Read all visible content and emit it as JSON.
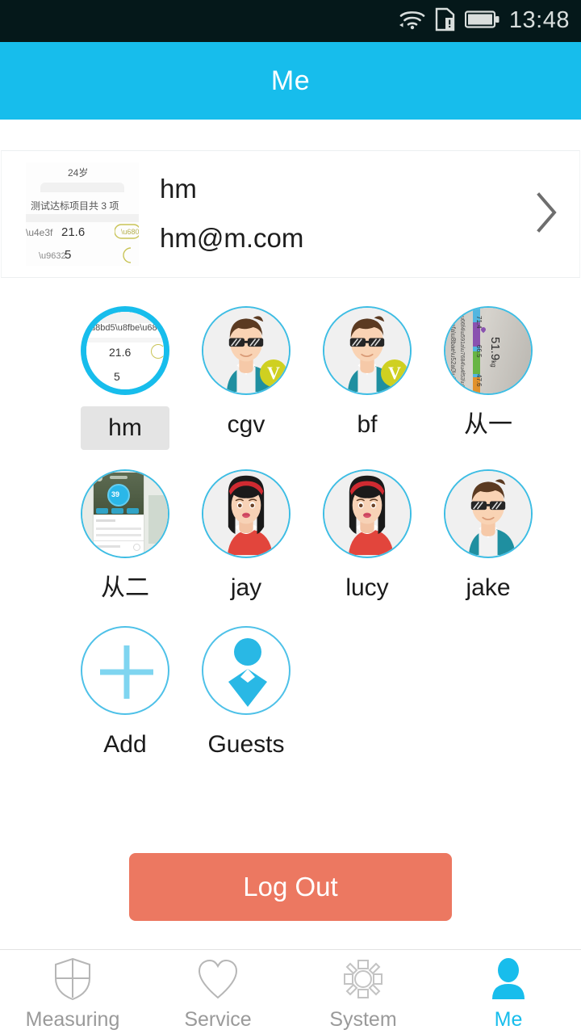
{
  "status_bar": {
    "time": "13:48",
    "icons": [
      "wifi-icon",
      "sim-card-alert-icon",
      "battery-icon"
    ],
    "background": "#05181a"
  },
  "header": {
    "title": "Me",
    "background": "#17bdec",
    "text_color": "#ffffff"
  },
  "profile_card": {
    "name": "hm",
    "email": "hm@m.com",
    "chevron": "chevron-right-icon",
    "thumbnail": {
      "type": "report-screenshot",
      "lines": [
        "24岁",
        "测试达标项目共 3 项",
        "21.6",
        "5"
      ],
      "highlight_value": "3"
    }
  },
  "members": [
    {
      "label": "hm",
      "avatar": "report-thumbnail",
      "selected": true,
      "verified": false
    },
    {
      "label": "cgv",
      "avatar": "male-sunglasses",
      "selected": false,
      "verified": true
    },
    {
      "label": "bf",
      "avatar": "male-sunglasses",
      "selected": false,
      "verified": true
    },
    {
      "label": "从一",
      "avatar": "scale-photo",
      "selected": false,
      "verified": false
    },
    {
      "label": "从二",
      "avatar": "app-screenshot",
      "selected": false,
      "verified": false
    },
    {
      "label": "jay",
      "avatar": "female-headband",
      "selected": false,
      "verified": false
    },
    {
      "label": "lucy",
      "avatar": "female-headband",
      "selected": false,
      "verified": false
    },
    {
      "label": "jake",
      "avatar": "male-sunglasses",
      "selected": false,
      "verified": false
    }
  ],
  "actions": [
    {
      "label": "Add",
      "icon": "plus-icon"
    },
    {
      "label": "Guests",
      "icon": "guest-person-icon"
    }
  ],
  "logout": {
    "label": "Log Out",
    "color": "#ec7861"
  },
  "tabbar": {
    "active_index": 3,
    "active_color": "#17bdec",
    "inactive_color": "#9a9a9a",
    "tabs": [
      {
        "label": "Measuring",
        "icon": "shield-icon"
      },
      {
        "label": "Service",
        "icon": "heart-icon"
      },
      {
        "label": "System",
        "icon": "gear-icon"
      },
      {
        "label": "Me",
        "icon": "person-icon"
      }
    ]
  },
  "avatar_photo_details": {
    "scale_photo_values": [
      "71.4",
      "66.5",
      "47.6",
      "51.9kg"
    ],
    "app_screenshot_value": "39"
  }
}
